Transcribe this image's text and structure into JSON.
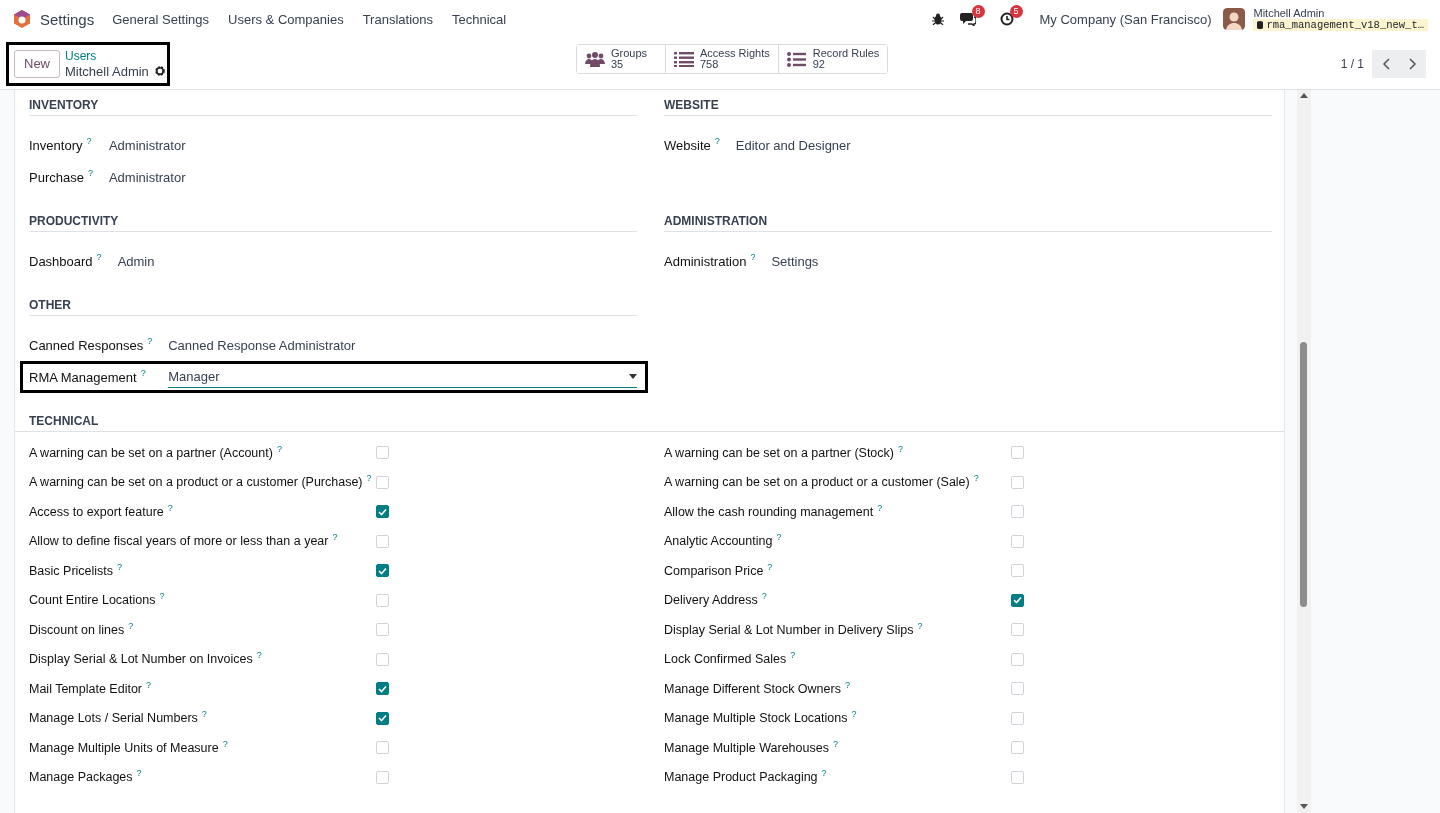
{
  "app": {
    "name": "Settings"
  },
  "menu": [
    "General Settings",
    "Users & Companies",
    "Translations",
    "Technical"
  ],
  "systray": {
    "chat_count": "8",
    "activity_count": "5",
    "company": "My Company (San Francisco)",
    "user_name": "Mitchell Admin",
    "database": "rma_management_v18_new_t…"
  },
  "control_panel": {
    "new_button": "New",
    "breadcrumb": "Users",
    "record": "Mitchell Admin",
    "highlighted": true,
    "smart_buttons": [
      {
        "kind": "groups",
        "label": "Groups",
        "value": "35"
      },
      {
        "kind": "list",
        "label": "Access Rights",
        "value": "758"
      },
      {
        "kind": "rules",
        "label": "Record Rules",
        "value": "92"
      }
    ],
    "pager": "1 / 1"
  },
  "sections": [
    {
      "columns": [
        {
          "title": "INVENTORY",
          "fields": [
            {
              "kind": "text",
              "label": "Inventory",
              "help": "?",
              "value": "Administrator",
              "highlighted": false
            },
            {
              "kind": "text",
              "label": "Purchase",
              "help": "?",
              "value": "Administrator",
              "highlighted": false
            }
          ]
        },
        {
          "title": "WEBSITE",
          "fields": [
            {
              "kind": "text",
              "label": "Website",
              "help": "?",
              "value": "Editor and Designer",
              "highlighted": false
            }
          ]
        }
      ]
    },
    {
      "columns": [
        {
          "title": "PRODUCTIVITY",
          "fields": [
            {
              "kind": "text",
              "label": "Dashboard",
              "help": "?",
              "value": "Admin",
              "highlighted": false
            }
          ]
        },
        {
          "title": "ADMINISTRATION",
          "fields": [
            {
              "kind": "text",
              "label": "Administration",
              "help": "?",
              "value": "Settings",
              "highlighted": false
            }
          ]
        }
      ]
    },
    {
      "columns": [
        {
          "title": "OTHER",
          "fields": [
            {
              "kind": "text",
              "label": "Canned Responses",
              "help": "?",
              "value": "Canned Response Administrator",
              "highlighted": false
            },
            {
              "kind": "select",
              "label": "RMA Management",
              "help": "?",
              "value": "Manager",
              "highlighted": true
            }
          ]
        }
      ]
    }
  ],
  "technical": {
    "title": "TECHNICAL",
    "columns": [
      [
        {
          "label": "A warning can be set on a partner (Account)",
          "help": "?",
          "checked": false
        },
        {
          "label": "A warning can be set on a product or a customer (Purchase)",
          "help": "?",
          "checked": false
        },
        {
          "label": "Access to export feature",
          "help": "?",
          "checked": true
        },
        {
          "label": "Allow to define fiscal years of more or less than a year",
          "help": "?",
          "checked": false
        },
        {
          "label": "Basic Pricelists",
          "help": "?",
          "checked": true
        },
        {
          "label": "Count Entire Locations",
          "help": "?",
          "checked": false
        },
        {
          "label": "Discount on lines",
          "help": "?",
          "checked": false
        },
        {
          "label": "Display Serial & Lot Number on Invoices",
          "help": "?",
          "checked": false
        },
        {
          "label": "Mail Template Editor",
          "help": "?",
          "checked": true
        },
        {
          "label": "Manage Lots / Serial Numbers",
          "help": "?",
          "checked": true
        },
        {
          "label": "Manage Multiple Units of Measure",
          "help": "?",
          "checked": false
        },
        {
          "label": "Manage Packages",
          "help": "?",
          "checked": false
        }
      ],
      [
        {
          "label": "A warning can be set on a partner (Stock)",
          "help": "?",
          "checked": false
        },
        {
          "label": "A warning can be set on a product or a customer (Sale)",
          "help": "?",
          "checked": false
        },
        {
          "label": "Allow the cash rounding management",
          "help": "?",
          "checked": false
        },
        {
          "label": "Analytic Accounting",
          "help": "?",
          "checked": false
        },
        {
          "label": "Comparison Price",
          "help": "?",
          "checked": false
        },
        {
          "label": "Delivery Address",
          "help": "?",
          "checked": true
        },
        {
          "label": "Display Serial & Lot Number in Delivery Slips",
          "help": "?",
          "checked": false
        },
        {
          "label": "Lock Confirmed Sales",
          "help": "?",
          "checked": false
        },
        {
          "label": "Manage Different Stock Owners",
          "help": "?",
          "checked": false
        },
        {
          "label": "Manage Multiple Stock Locations",
          "help": "?",
          "checked": false
        },
        {
          "label": "Manage Multiple Warehouses",
          "help": "?",
          "checked": false
        },
        {
          "label": "Manage Product Packaging",
          "help": "?",
          "checked": false
        }
      ]
    ]
  }
}
